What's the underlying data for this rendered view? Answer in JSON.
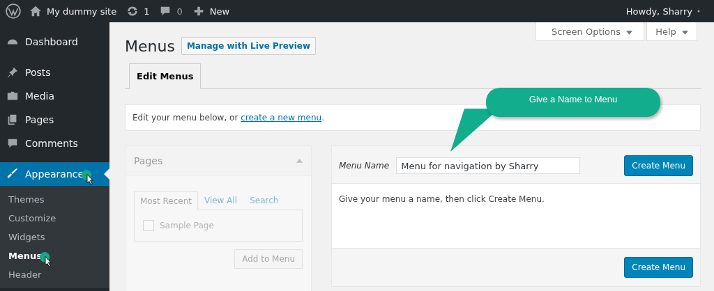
{
  "admin_bar": {
    "site_name": "My dummy site",
    "updates": "1",
    "comments": "0",
    "new": "New",
    "greeting": "Howdy, Sharry"
  },
  "sidebar": {
    "items": [
      {
        "label": "Dashboard",
        "selected": false,
        "marker": false
      },
      {
        "label": "Posts",
        "selected": false,
        "marker": false
      },
      {
        "label": "Media",
        "selected": false,
        "marker": false
      },
      {
        "label": "Pages",
        "selected": false,
        "marker": false
      },
      {
        "label": "Comments",
        "selected": false,
        "marker": false
      },
      {
        "label": "Appearance",
        "selected": true,
        "marker": true
      }
    ],
    "submenu": [
      {
        "label": "Themes",
        "selected": false,
        "marker": false
      },
      {
        "label": "Customize",
        "selected": false,
        "marker": false
      },
      {
        "label": "Widgets",
        "selected": false,
        "marker": false
      },
      {
        "label": "Menus",
        "selected": true,
        "marker": true
      },
      {
        "label": "Header",
        "selected": false,
        "marker": false
      }
    ]
  },
  "screen_tabs": [
    "Screen Options",
    "Help"
  ],
  "page_title": "Menus",
  "live_preview_button": "Manage with Live Preview",
  "tabs": [
    {
      "label": "Edit Menus",
      "selected": true
    }
  ],
  "notice": {
    "text": "Edit your menu below, or ",
    "link": "create a new menu",
    "end": "."
  },
  "pages_panel": {
    "title": "Pages",
    "tabs": [
      {
        "label": "Most Recent",
        "selected": true
      },
      {
        "label": "View All",
        "selected": false
      },
      {
        "label": "Search",
        "selected": false
      }
    ],
    "items": [
      {
        "label": "Sample Page",
        "checked": false
      }
    ],
    "button": "Add to Menu"
  },
  "menu_panel": {
    "name_label": "Menu Name",
    "name_value": "Menu for navigation by Sharry",
    "create_button": "Create Menu",
    "hint": "Give your menu a name, then click Create Menu.",
    "footer_button": "Create Menu"
  },
  "callout": "Give a Name to Menu"
}
